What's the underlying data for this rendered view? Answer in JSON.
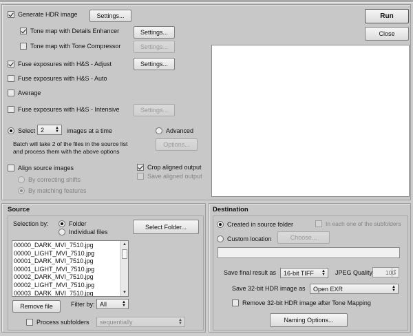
{
  "hdr": {
    "generate_label": "Generate HDR image",
    "settings_label": "Settings...",
    "details_enhancer_label": "Tone map with Details Enhancer",
    "tone_compressor_label": "Tone map with Tone Compressor"
  },
  "fuse": {
    "adjust_label": "Fuse exposures with H&S - Adjust",
    "auto_label": "Fuse exposures with H&S - Auto",
    "average_label": "Average",
    "intensive_label": "Fuse exposures with H&S - Intensive"
  },
  "select_mode": {
    "select_label": "Select",
    "count_value": "2",
    "images_label": "images at a time",
    "advanced_label": "Advanced",
    "description_line1": "Batch will take 2 of the files in the source list",
    "description_line2": "and process them with the above options",
    "options_label": "Options..."
  },
  "align": {
    "align_label": "Align source images",
    "correcting_label": "By correcting shifts",
    "matching_label": "By matching features",
    "crop_label": "Crop aligned output",
    "save_label": "Save aligned output"
  },
  "actions": {
    "run_label": "Run",
    "close_label": "Close"
  },
  "source": {
    "title": "Source",
    "selection_by_label": "Selection by:",
    "folder_label": "Folder",
    "individual_label": "Individual files",
    "select_folder_label": "Select Folder...",
    "files": [
      "00000_DARK_MVI_7510.jpg",
      "00000_LIGHT_MVI_7510.jpg",
      "00001_DARK_MVI_7510.jpg",
      "00001_LIGHT_MVI_7510.jpg",
      "00002_DARK_MVI_7510.jpg",
      "00002_LIGHT_MVI_7510.jpg",
      "00003_DARK_MVI_7510.jpg"
    ],
    "remove_label": "Remove file",
    "filter_label": "Filter by:",
    "filter_value": "All",
    "process_sub_label": "Process subfolders",
    "order_value": "sequentially"
  },
  "destination": {
    "title": "Destination",
    "created_label": "Created in source folder",
    "each_sub_label": "In each one of the subfolders",
    "custom_label": "Custom location",
    "choose_label": "Choose...",
    "path_value": "",
    "save_final_label": "Save final result as",
    "format_value": "16-bit TIFF",
    "jpeg_quality_label": "JPEG Quality:",
    "jpeg_quality_value": "100",
    "save_hdr_label": "Save 32-bit HDR image as",
    "hdr_format_value": "Open EXR",
    "remove_hdr_label": "Remove 32-bit HDR image after Tone Mapping",
    "naming_label": "Naming Options..."
  }
}
